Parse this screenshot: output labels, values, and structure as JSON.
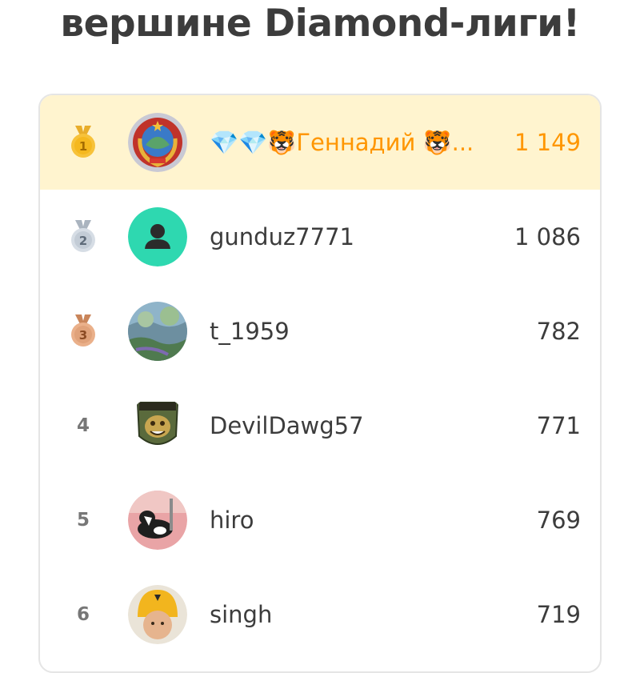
{
  "header": {
    "title": "вершине Diamond-лиги!"
  },
  "colors": {
    "highlight_bg": "#fff4cf",
    "highlight_text": "#ff9600",
    "gold": "#f7c23a",
    "silver": "#c3ccd6",
    "bronze": "#e0a27a"
  },
  "leaderboard": {
    "rows": [
      {
        "rank": "1",
        "medal": "gold-medal-icon",
        "username": "💎💎🐯Геннадий 🐯...",
        "xp": "1 149",
        "avatar": "emblem-avatar",
        "current_user": true
      },
      {
        "rank": "2",
        "medal": "silver-medal-icon",
        "username": "gunduz7771",
        "xp": "1 086",
        "avatar": "default-user-avatar"
      },
      {
        "rank": "3",
        "medal": "bronze-medal-icon",
        "username": "t_1959",
        "xp": "782",
        "avatar": "landscape-avatar"
      },
      {
        "rank": "4",
        "username": "DevilDawg57",
        "xp": "771",
        "avatar": "badge-avatar"
      },
      {
        "rank": "5",
        "username": "hiro",
        "xp": "769",
        "avatar": "dog-avatar"
      },
      {
        "rank": "6",
        "username": "singh",
        "xp": "719",
        "avatar": "child-avatar"
      }
    ]
  }
}
